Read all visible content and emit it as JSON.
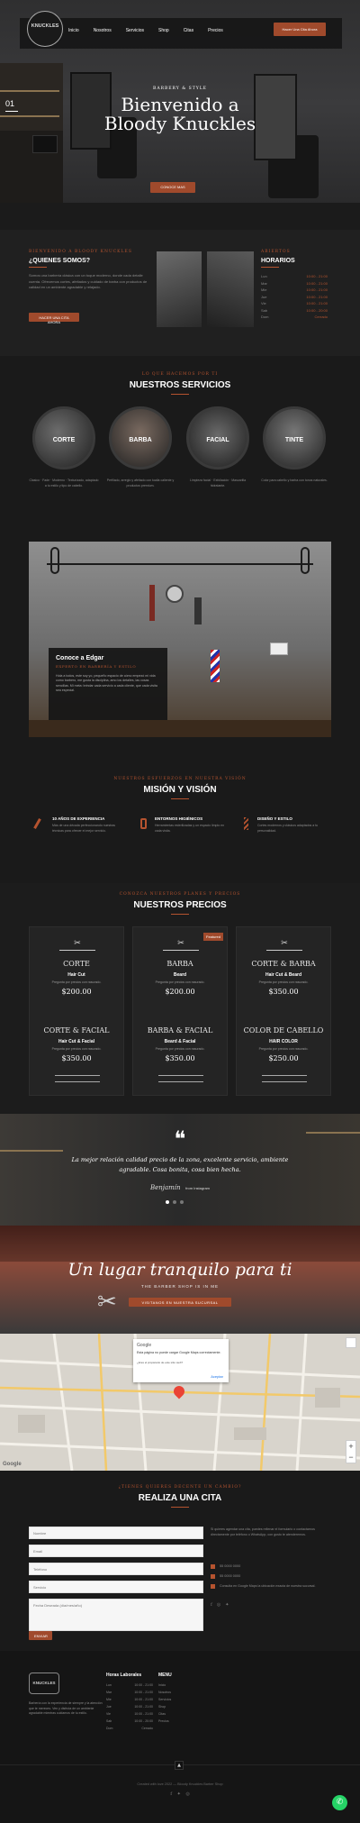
{
  "nav": {
    "logo_text": "KNUCKLES",
    "items": [
      "Inicio",
      "Nosotros",
      "Servicios",
      "Shop",
      "Citas",
      "Precios"
    ],
    "cta": "Hacer Una Cita Ahora"
  },
  "hero": {
    "slide_number": "01",
    "subtitle": "BARBERY & STYLE",
    "title_line1": "Bienvenido a",
    "title_line2": "Bloody Knuckles",
    "button": "CONOCE MAS"
  },
  "about": {
    "kicker": "BIENVENIDO A BLOODY KNUCKLES",
    "heading": "¿QUIENES SOMOS?",
    "text": "Somos una barbería clásica con un toque moderno, donde cada detalle cuenta. Ofrecemos cortes, afeitados y cuidado de barba con productos de calidad en un ambiente agradable y relajado.",
    "button": "HACER UNA CITA AHORA"
  },
  "hours": {
    "kicker": "ABIERTOS",
    "heading": "HORARIOS",
    "rows": [
      {
        "day": "Lun",
        "time": "10:00 - 21:00"
      },
      {
        "day": "Mar",
        "time": "10:00 - 21:00"
      },
      {
        "day": "Mie",
        "time": "10:00 - 21:00"
      },
      {
        "day": "Jue",
        "time": "10:00 - 21:00"
      },
      {
        "day": "Vie",
        "time": "10:00 - 21:00"
      },
      {
        "day": "Sab",
        "time": "10:00 - 20:00"
      },
      {
        "day": "Dom",
        "time": "Cerrado"
      }
    ]
  },
  "services": {
    "kicker": "LO QUE HACEMOS POR TI",
    "heading": "NUESTROS SERVICIOS",
    "items": [
      {
        "label": "CORTE",
        "desc": "Clasico · Fade · Moderno · Texturizado, adaptado a tu estilo y tipo de cabello."
      },
      {
        "label": "BARBA",
        "desc": "Perfilado, arreglo y afeitado con toalla caliente y productos premium."
      },
      {
        "label": "FACIAL",
        "desc": "Limpieza facial · Exfoliación · Mascarilla hidratante."
      },
      {
        "label": "TINTE",
        "desc": "Color para cabello y barba con tonos naturales."
      }
    ]
  },
  "edgar": {
    "title": "Conoce a Edgar",
    "subtitle": "EXPERTO EN BARBERÍA Y ESTILO",
    "text": "Hola a todos, este soy yo, pequeño espacio de cómo empezó mi vida como barbero, me gusta la disciplina, amo los detalles, las cosas sencillas. Mi meta: brindar cada servicio a cada cliente, que cada visita sea especial."
  },
  "mission": {
    "kicker": "NUESTROS ESFUERZOS EN NUESTRA VISIÓN",
    "heading": "MISIÓN Y VISIÓN",
    "items": [
      {
        "icon": "razor-icon",
        "title": "10 AÑOS DE EXPERIENCIA",
        "text": "Más de una década perfeccionando nuestras técnicas para ofrecer el mejor servicio."
      },
      {
        "icon": "bottle-icon",
        "title": "ENTORNOS HIGIÉNICOS",
        "text": "Herramientas esterilizadas y un espacio limpio en cada visita."
      },
      {
        "icon": "barber-pole-icon",
        "title": "DISEÑO Y ESTILO",
        "text": "Cortes modernos y clásicos adaptados a tu personalidad."
      }
    ]
  },
  "prices": {
    "kicker": "CONOZCA NUESTROS PLANES Y PRECIOS",
    "heading": "NUESTROS PRECIOS",
    "badge": "Featured",
    "cards": [
      {
        "rows": [
          {
            "title": "CORTE",
            "sub": "Hair Cut",
            "desc": "Pregunta por precios con rasurado.",
            "price": "$200.00"
          },
          {
            "title": "CORTE & FACIAL",
            "sub": "Hair Cut & Facial",
            "desc": "Pregunta por precios con rasurado.",
            "price": "$350.00"
          }
        ]
      },
      {
        "rows": [
          {
            "title": "BARBA",
            "sub": "Beard",
            "desc": "Pregunta por precios con rasurado.",
            "price": "$200.00"
          },
          {
            "title": "BARBA & FACIAL",
            "sub": "Beard & Facial",
            "desc": "Pregunta por precios con rasurado.",
            "price": "$350.00"
          }
        ]
      },
      {
        "rows": [
          {
            "title": "CORTE & BARBA",
            "sub": "Hair Cut & Beard",
            "desc": "Pregunta por precios con rasurado.",
            "price": "$350.00"
          },
          {
            "title": "COLOR DE CABELLO",
            "sub": "HAIR COLOR",
            "desc": "Pregunta por precios con rasurado.",
            "price": "$250.00"
          }
        ]
      }
    ]
  },
  "testimonial": {
    "quote": "La mejor relación calidad precio de la zona, excelente servicio, ambiente agradable. Cosa bonita, cosa bien hecha.",
    "author": "Benjamín",
    "source": "from Instagram"
  },
  "banner": {
    "title": "Un lugar tranquilo para ti",
    "subtitle": "THE BARBER SHOP IS IN ME",
    "button": "VISITANOS EN NUESTRA SUCURSAL"
  },
  "map": {
    "dialog_title": "Google",
    "dialog_text": "Esta página no puede cargar Google Maps correctamente.",
    "dialog_question": "¿Eres el propietario de este sitio web?",
    "dialog_button": "Aceptar",
    "google": "Google",
    "zoom_in": "+",
    "zoom_out": "−"
  },
  "appointment": {
    "kicker": "¿TIENES QUIERES DECENTE UN CAMBIO?",
    "heading": "REALIZA UNA CITA",
    "fields": [
      "Nombre",
      "Email",
      "Teléfono",
      "Servicio"
    ],
    "message_placeholder": "Fecha Deseada (día/mes/año)",
    "submit": "ENVIAR",
    "info_text": "Si quieres agendar una cita, puedes rellenar el formulario o contactarnos directamente por teléfono o WhatsApp, con gusto te atenderemos.",
    "phone1": "55 0000 0000",
    "phone2": "55 0000 0000",
    "address": "Consulta en Google Maps la ubicación exacta de nuestra sucursal."
  },
  "footer": {
    "about_text": "Barbería con la experiencia de siempre y la atención que te mereces. Ven y disfruta de un ambiente agradable mientras cuidamos de tu estilo.",
    "hours_heading": "Horas Laborales",
    "menu_heading": "MENU",
    "hours": [
      {
        "day": "Lun",
        "time": "10:00 - 21:00"
      },
      {
        "day": "Mar",
        "time": "10:00 - 21:00"
      },
      {
        "day": "Mie",
        "time": "10:00 - 21:00"
      },
      {
        "day": "Jue",
        "time": "10:00 - 21:00"
      },
      {
        "day": "Vie",
        "time": "10:00 - 21:00"
      },
      {
        "day": "Sab",
        "time": "10:00 - 20:00"
      },
      {
        "day": "Dom",
        "time": "Cerrado"
      }
    ],
    "menu": [
      "Inicio",
      "Nosotros",
      "Servicios",
      "Shop",
      "Citas",
      "Precios"
    ],
    "copyright": "Created with love 2022 — Bloody Knuckles Barber Shop"
  },
  "colors": {
    "accent": "#b5532f",
    "background": "#1a1a1a",
    "whatsapp": "#25d366"
  }
}
